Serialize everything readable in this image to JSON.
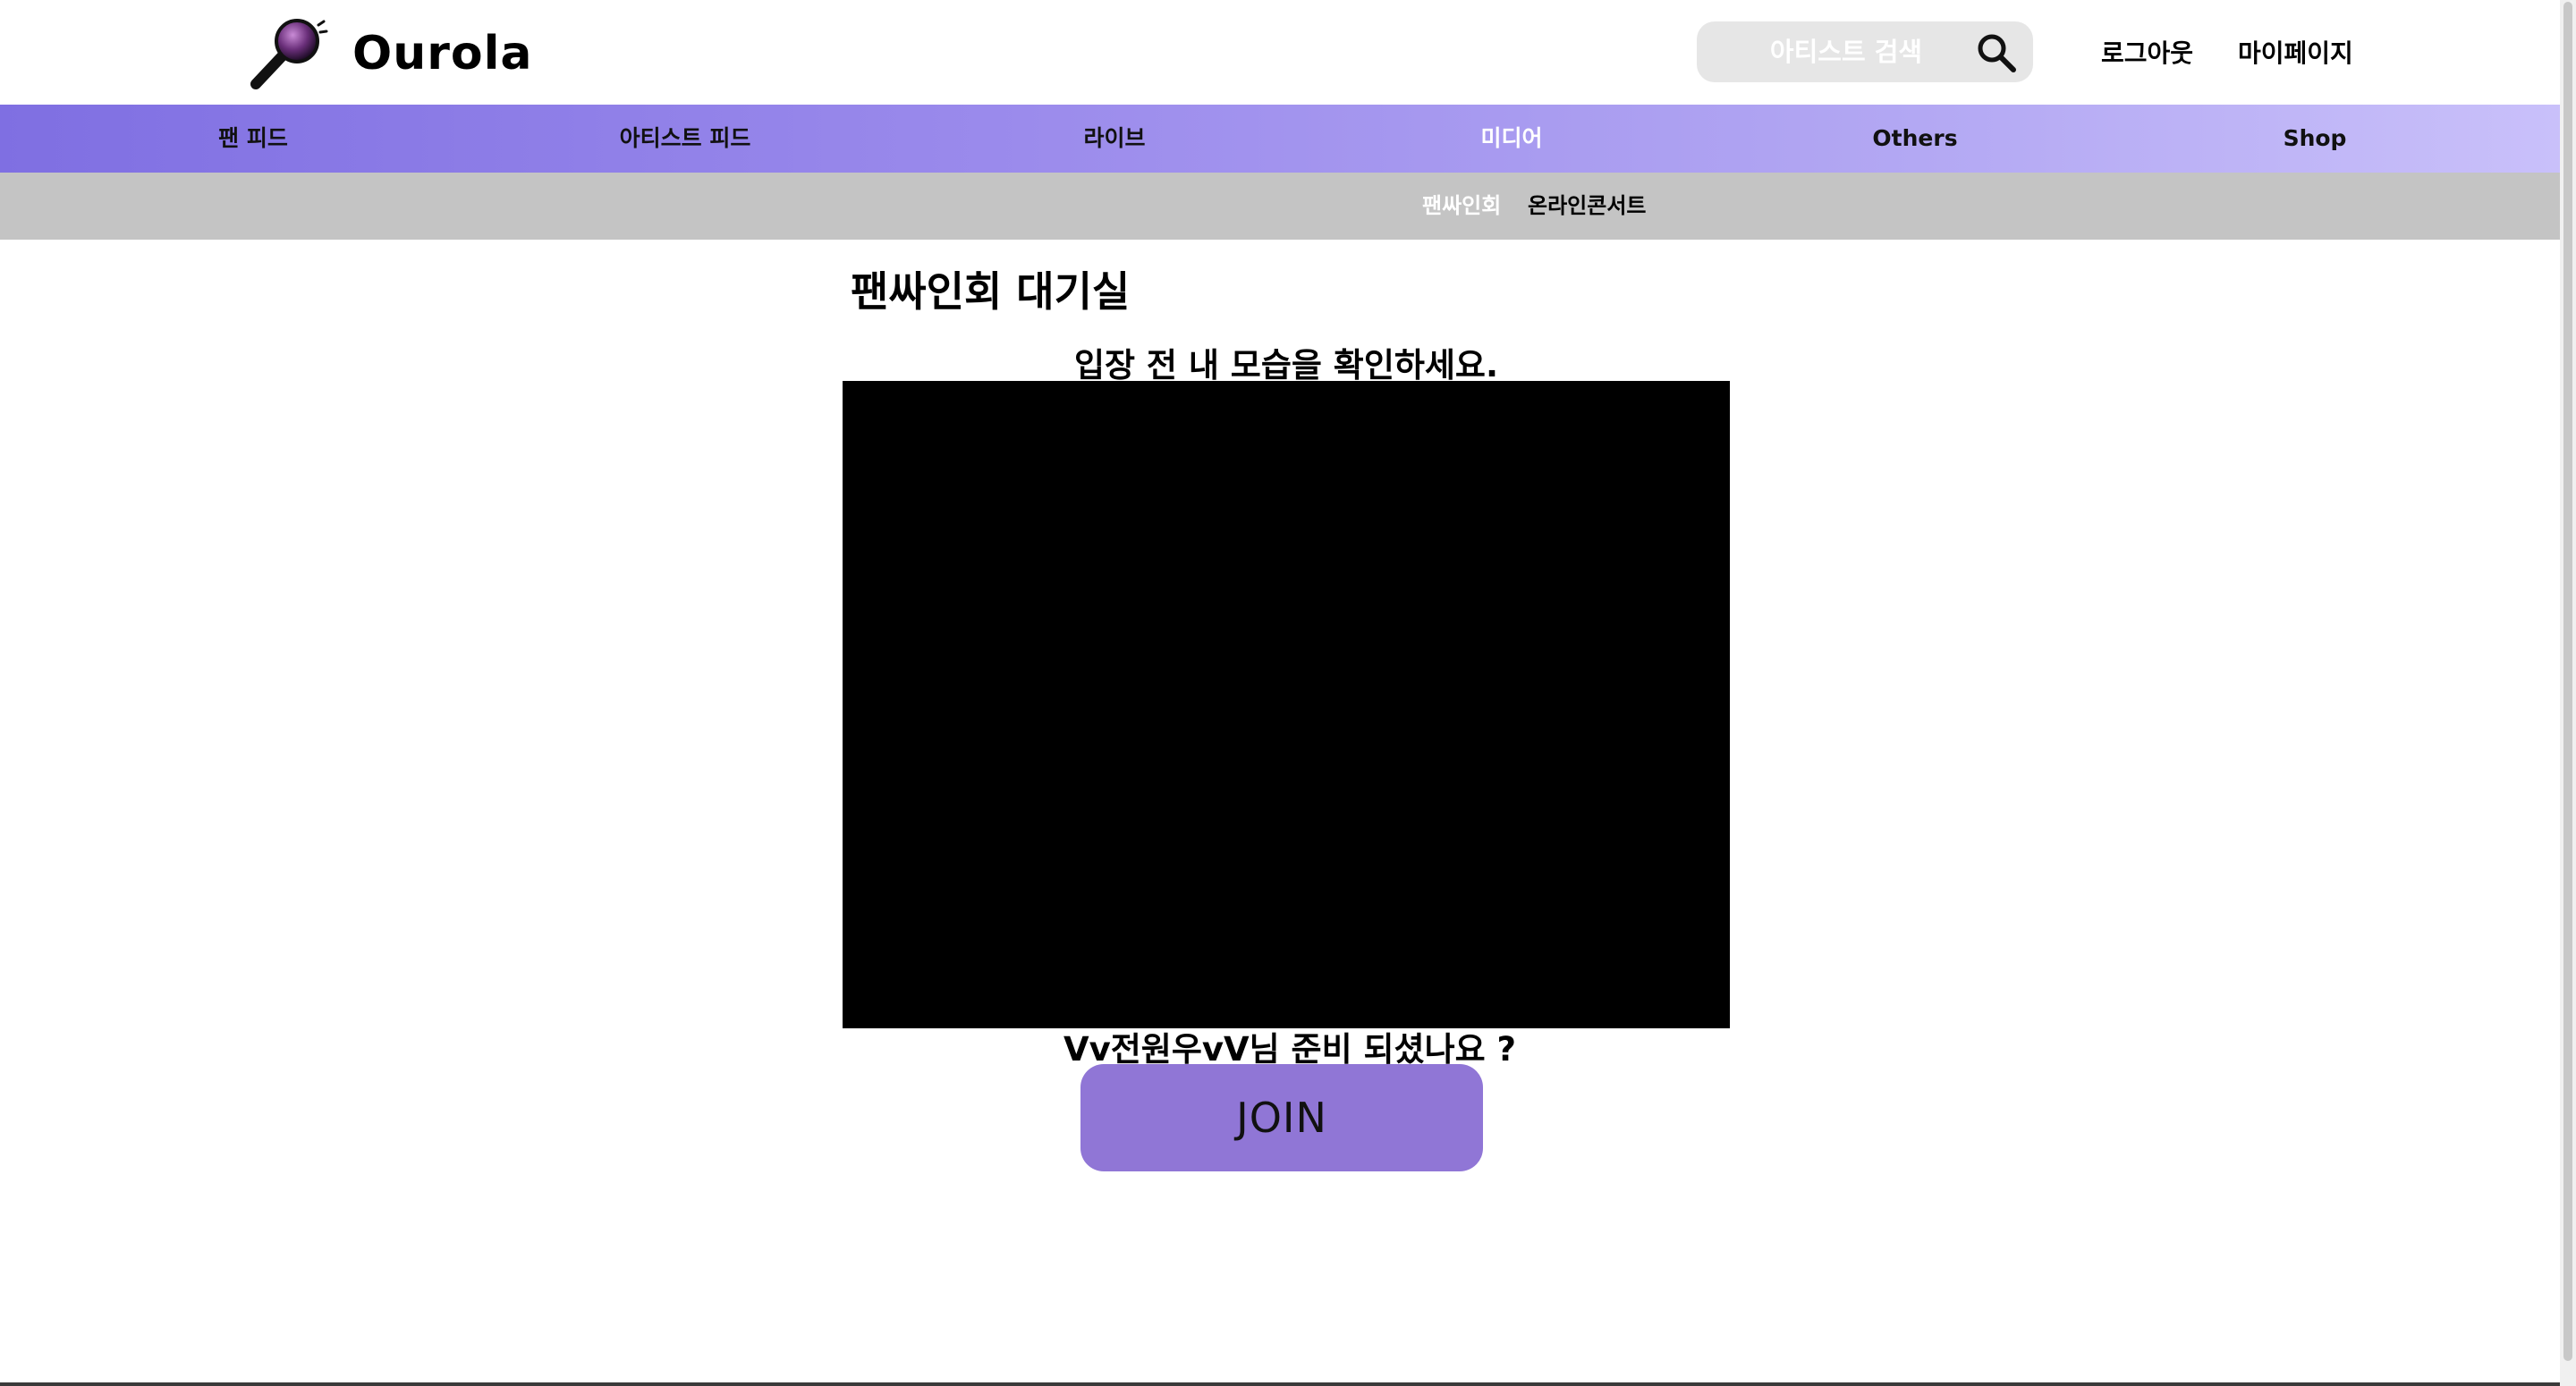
{
  "header": {
    "logo_text": "Ourola",
    "logo_icon": "microphone-icon",
    "search_placeholder": "아티스트 검색",
    "search_icon": "search-icon",
    "logout_label": "로그아웃",
    "mypage_label": "마이페이지"
  },
  "main_nav": {
    "items": [
      {
        "label": "팬 피드",
        "active": false
      },
      {
        "label": "아티스트 피드",
        "active": false
      },
      {
        "label": "라이브",
        "active": false
      },
      {
        "label": "미디어",
        "active": true
      },
      {
        "label": "Others",
        "active": false
      },
      {
        "label": "Shop",
        "active": false
      }
    ]
  },
  "sub_nav": {
    "items": [
      {
        "label": "팬싸인회",
        "active": true
      },
      {
        "label": "온라인콘서트",
        "active": false
      }
    ]
  },
  "content": {
    "title": "팬싸인회 대기실",
    "preview_caption": "입장 전 내 모습을 확인하세요.",
    "ready_text": "Vv전원우vV님 준비 되셨나요 ?",
    "join_label": "JOIN"
  },
  "colors": {
    "nav_gradient_start": "#7f6fe2",
    "nav_gradient_end": "#c9c0fa",
    "sub_nav_bg": "#c4c4c4",
    "join_button": "#9076d6",
    "video_bg": "#000000",
    "search_bg": "#e6e6e6"
  }
}
